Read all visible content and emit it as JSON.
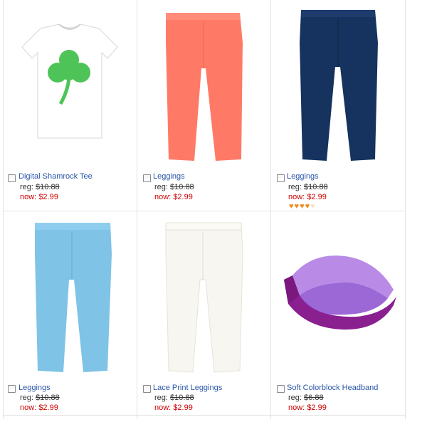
{
  "products": [
    {
      "name": "Digital Shamrock Tee",
      "reg_label": "reg:",
      "reg_price": "$10.88",
      "now_label": "now:",
      "now_price": "$2.99",
      "image": "shamrock-tee",
      "color": "#ffffff"
    },
    {
      "name": "Leggings",
      "reg_label": "reg:",
      "reg_price": "$10.88",
      "now_label": "now:",
      "now_price": "$2.99",
      "image": "leggings",
      "color": "#ff7a66"
    },
    {
      "name": "Leggings",
      "reg_label": "reg:",
      "reg_price": "$10.88",
      "now_label": "now:",
      "now_price": "$2.99",
      "image": "leggings",
      "color": "#16325e",
      "rating": 4,
      "rating_max": 5
    },
    {
      "name": "Leggings",
      "reg_label": "reg:",
      "reg_price": "$10.88",
      "now_label": "now:",
      "now_price": "$2.99",
      "image": "leggings",
      "color": "#7fc3e6"
    },
    {
      "name": "Lace Print Leggings",
      "reg_label": "reg:",
      "reg_price": "$10.88",
      "now_label": "now:",
      "now_price": "$2.99",
      "image": "leggings",
      "color": "#f7f6f0"
    },
    {
      "name": "Soft Colorblock Headband",
      "reg_label": "reg:",
      "reg_price": "$6.88",
      "now_label": "now:",
      "now_price": "$2.99",
      "image": "headband",
      "color": "#8a1f8f"
    }
  ],
  "colors": {
    "link": "#2a57a8",
    "sale": "#cc0000",
    "star_on": "#f08a1c",
    "star_off": "#f1e3cf",
    "shamrock": "#3fbf4a"
  }
}
